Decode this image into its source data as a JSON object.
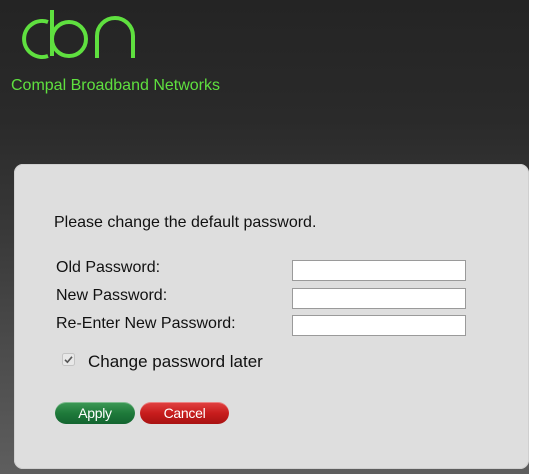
{
  "brand": {
    "logo_text": "cbn",
    "tagline": "Compal Broadband Networks",
    "color": "#5fe03f"
  },
  "form": {
    "message": "Please change the default password.",
    "fields": [
      {
        "label": "Old Password:",
        "value": ""
      },
      {
        "label": "New Password:",
        "value": ""
      },
      {
        "label": "Re-Enter New Password:",
        "value": ""
      }
    ],
    "checkbox": {
      "label": "Change password later",
      "checked": true
    },
    "buttons": {
      "apply": "Apply",
      "cancel": "Cancel"
    }
  },
  "colors": {
    "apply": "#1f7a3a",
    "cancel": "#c81d1d",
    "panel": "#dedede"
  }
}
